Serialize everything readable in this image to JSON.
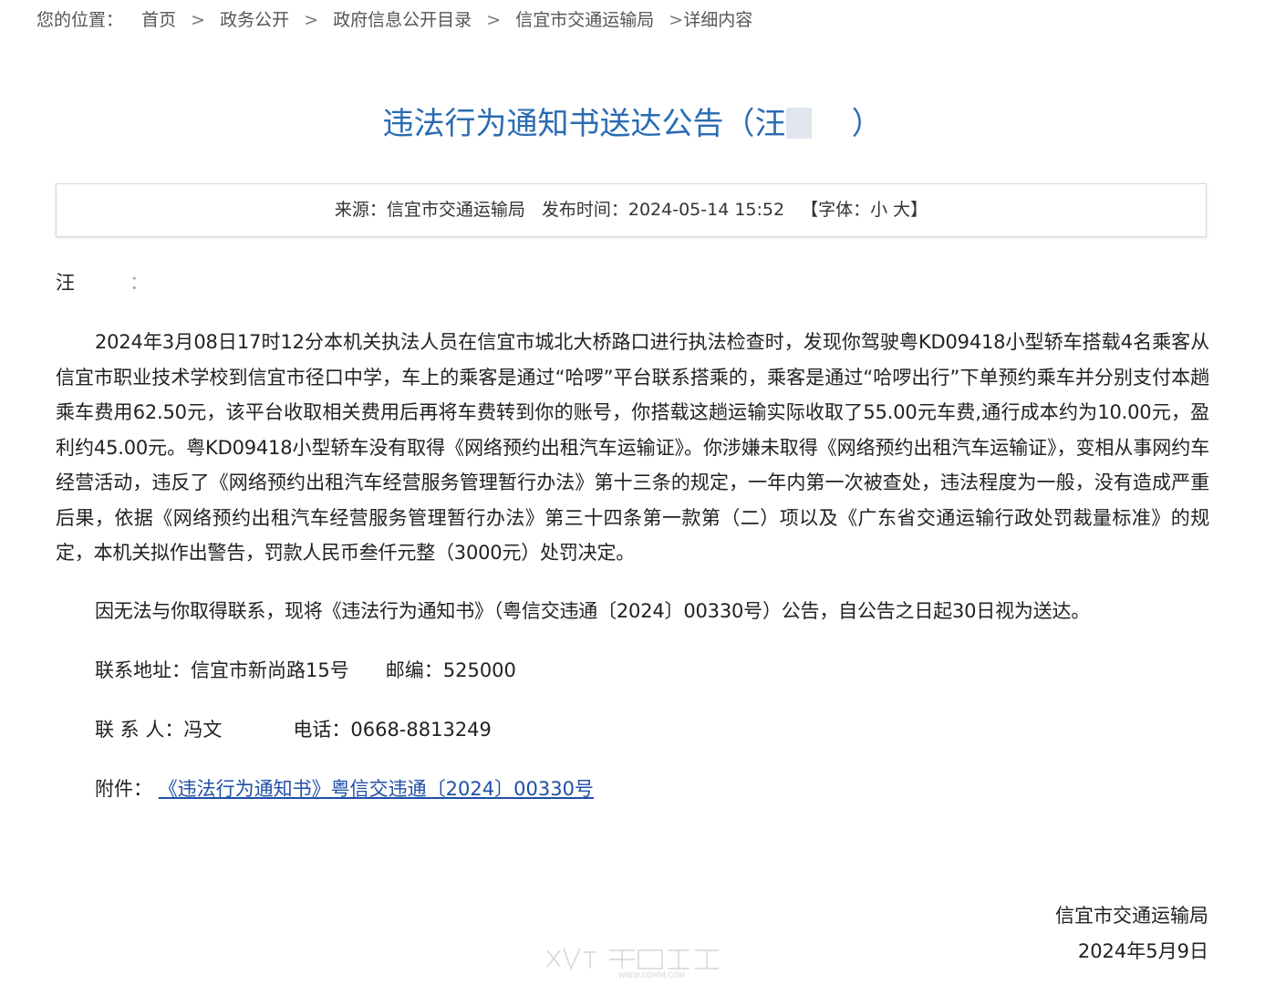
{
  "breadcrumb": {
    "prefix": "您的位置：",
    "items": [
      "首页",
      "政务公开",
      "政府信息公开目录",
      "信宜市交通运输局"
    ],
    "last": "详细内容",
    "separator": ">"
  },
  "article": {
    "title_before": "违法行为通知书送达公告（汪",
    "title_after": "）",
    "meta": {
      "source_label": "来源：",
      "source": "信宜市交通运输局",
      "time_label": "发布时间：",
      "time": "2024-05-14 15:52",
      "fontsize_label": "【字体：",
      "fontsize_small": "小",
      "fontsize_large": "大",
      "fontsize_close": "】"
    },
    "salutation": "汪",
    "salutation_colon": "：",
    "paragraph1": "2024年3月08日17时12分本机关执法人员在信宜市城北大桥路口进行执法检查时，发现你驾驶粤KD09418小型轿车搭载4名乘客从信宜市职业技术学校到信宜市径口中学，车上的乘客是通过“哈啰”平台联系搭乘的，乘客是通过“哈啰出行”下单预约乘车并分别支付本趟乘车费用62.50元，该平台收取相关费用后再将车费转到你的账号，你搭载这趟运输实际收取了55.00元车费,通行成本约为10.00元，盈利约45.00元。粤KD09418小型轿车没有取得《网络预约出租汽车运输证》。你涉嫌未取得《网络预约出租汽车运输证》，变相从事网约车经营活动，违反了《网络预约出租汽车经营服务管理暂行办法》第十三条的规定，一年内第一次被查处，违法程度为一般，没有造成严重后果，依据《网络预约出租汽车经营服务管理暂行办法》第三十四条第一款第（二）项以及《广东省交通运输行政处罚裁量标准》的规定，本机关拟作出警告，罚款人民币叁仟元整（3000元）处罚决定。",
    "paragraph2": "因无法与你取得联系，现将《违法行为通知书》（粤信交违通〔2024〕00330号）公告，自公告之日起30日视为送达。",
    "contact": {
      "address_label": "联系地址：",
      "address": "信宜市新尚路15号",
      "postcode_label": "邮编：",
      "postcode": "525000",
      "person_label": "联 系 人：",
      "person": "冯文",
      "phone_label": "电话：",
      "phone": "0668-8813249",
      "attachment_label": "附件：",
      "attachment_link": "《违法行为通知书》粤信交违通〔2024〕00330号"
    },
    "signature": {
      "org": "信宜市交通运输局",
      "date": "2024年5月9日"
    }
  },
  "watermark": {
    "brand": "茂名在线",
    "url": "WWW.GDMM.COM"
  }
}
